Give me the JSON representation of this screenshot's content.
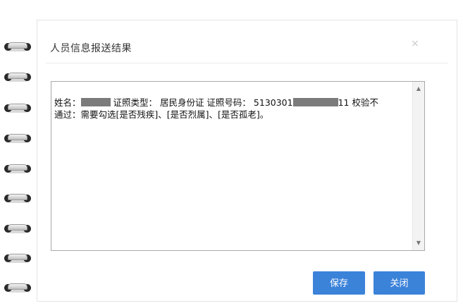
{
  "dialog": {
    "title": "人员信息报送结果",
    "close_glyph": "×",
    "result": {
      "line1_prefix": "姓名：",
      "line1_middle": " 证照类型： 居民身份证 证照号码： 5130301",
      "line1_suffix": "11 校验不",
      "line2": "通过：需要勾选[是否残疾]、[是否烈属]、[是否孤老]。"
    },
    "buttons": {
      "save": "保存",
      "close": "关闭"
    }
  },
  "colors": {
    "button_bg": "#3b82d9",
    "border": "#a9a9a9",
    "redaction": "#7b7b7b"
  }
}
